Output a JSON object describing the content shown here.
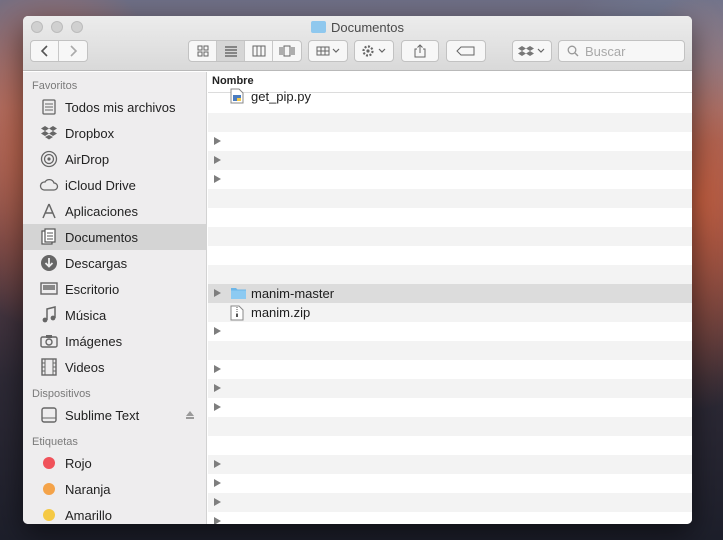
{
  "window": {
    "title": "Documentos"
  },
  "toolbar": {
    "back_icon": "chevron-left-icon",
    "forward_icon": "chevron-right-icon",
    "view_icons": [
      "icon-view-icon",
      "list-view-icon",
      "column-view-icon",
      "coverflow-view-icon"
    ],
    "active_view": 1,
    "search_placeholder": "Buscar"
  },
  "sidebar": {
    "favorites_header": "Favoritos",
    "favorites": [
      {
        "label": "Todos mis archivos",
        "icon": "all-files-icon"
      },
      {
        "label": "Dropbox",
        "icon": "dropbox-icon"
      },
      {
        "label": "AirDrop",
        "icon": "airdrop-icon"
      },
      {
        "label": "iCloud Drive",
        "icon": "cloud-icon"
      },
      {
        "label": "Aplicaciones",
        "icon": "applications-icon"
      },
      {
        "label": "Documentos",
        "icon": "documents-icon",
        "selected": true
      },
      {
        "label": "Descargas",
        "icon": "downloads-icon"
      },
      {
        "label": "Escritorio",
        "icon": "desktop-icon"
      },
      {
        "label": "Música",
        "icon": "music-icon"
      },
      {
        "label": "Imágenes",
        "icon": "camera-icon"
      },
      {
        "label": "Videos",
        "icon": "film-icon"
      }
    ],
    "devices_header": "Dispositivos",
    "devices": [
      {
        "label": "Sublime Text",
        "icon": "disk-icon"
      }
    ],
    "tags_header": "Etiquetas",
    "tags": [
      {
        "label": "Rojo",
        "color": "#f0525a"
      },
      {
        "label": "Naranja",
        "color": "#f4a349"
      },
      {
        "label": "Amarillo",
        "color": "#f5c944"
      }
    ]
  },
  "content": {
    "column_header": "Nombre",
    "files": [
      {
        "row": 0,
        "name": "get_pip.py",
        "icon": "python-file-icon"
      },
      {
        "row": 10,
        "name": "manim-master",
        "icon": "folder-icon"
      },
      {
        "row": 11,
        "name": "manim.zip",
        "icon": "zip-file-icon"
      }
    ]
  }
}
